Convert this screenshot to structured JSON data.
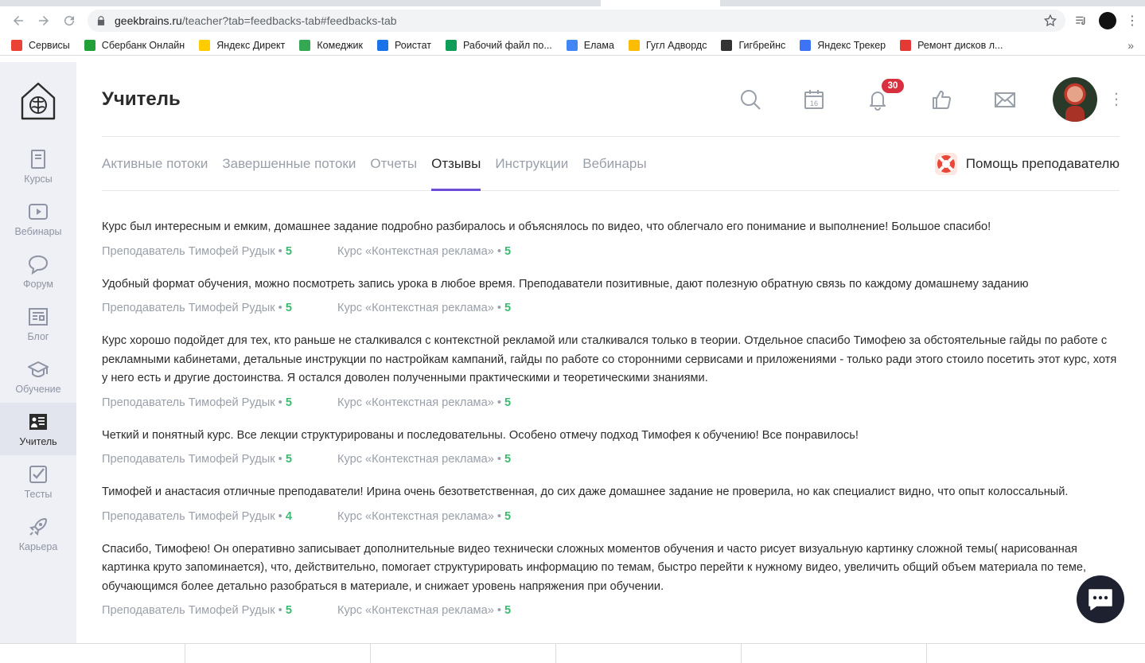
{
  "browser": {
    "url_host": "geekbrains.ru",
    "url_path": "/teacher?tab=feedbacks-tab#feedbacks-tab",
    "bookmarks": [
      {
        "label": "Сервисы",
        "color": "#ea4335"
      },
      {
        "label": "Сбербанк Онлайн",
        "color": "#21a038"
      },
      {
        "label": "Яндекс Директ",
        "color": "#ffcc00"
      },
      {
        "label": "Комеджик",
        "color": "#34a853"
      },
      {
        "label": "Роистат",
        "color": "#1a73e8"
      },
      {
        "label": "Рабочий файл по...",
        "color": "#0f9d58"
      },
      {
        "label": "Елама",
        "color": "#4285f4"
      },
      {
        "label": "Гугл Адвордс",
        "color": "#fbbc04"
      },
      {
        "label": "Гигбрейнс",
        "color": "#333333"
      },
      {
        "label": "Яндекс Трекер",
        "color": "#3d73f5"
      },
      {
        "label": "Ремонт дисков л...",
        "color": "#e53935"
      }
    ],
    "more": "»"
  },
  "sidebar": {
    "items": [
      {
        "label": "Курсы",
        "icon": "book-icon"
      },
      {
        "label": "Вебинары",
        "icon": "video-icon"
      },
      {
        "label": "Форум",
        "icon": "chat-bubble-icon"
      },
      {
        "label": "Блог",
        "icon": "newspaper-icon"
      },
      {
        "label": "Обучение",
        "icon": "graduation-cap-icon"
      },
      {
        "label": "Учитель",
        "icon": "teacher-board-icon"
      },
      {
        "label": "Тесты",
        "icon": "checkbox-icon"
      },
      {
        "label": "Карьера",
        "icon": "rocket-icon"
      }
    ],
    "active_index": 5
  },
  "header": {
    "title": "Учитель",
    "calendar_day": "16",
    "notifications_count": "30"
  },
  "tabs": [
    {
      "label": "Активные потоки"
    },
    {
      "label": "Завершенные потоки"
    },
    {
      "label": "Отчеты"
    },
    {
      "label": "Отзывы"
    },
    {
      "label": "Инструкции"
    },
    {
      "label": "Вебинары"
    }
  ],
  "active_tab_index": 3,
  "help_label": "Помощь преподавателю",
  "feedbacks": [
    {
      "text": "Курс был интересным и емким, домашнее задание подробно разбиралось и объяснялось по видео, что облегчало его понимание и выполнение! Большое спасибо!",
      "teacher": "Преподаватель Тимофей Рудык • ",
      "teacher_score": "5",
      "course": "Курс «Контекстная реклама» • ",
      "course_score": "5"
    },
    {
      "text": "Удобный формат обучения, можно посмотреть запись урока в любое время. Преподаватели позитивные, дают полезную обратную связь по каждому домашнему заданию",
      "teacher": "Преподаватель Тимофей Рудык • ",
      "teacher_score": "5",
      "course": "Курс «Контекстная реклама» • ",
      "course_score": "5"
    },
    {
      "text": "Курс хорошо подойдет для тех, кто раньше не сталкивался с контекстной рекламой или сталкивался только в теории. Отдельное спасибо Тимофею за обстоятельные гайды по работе с рекламными кабинетами, детальные инструкции по настройкам кампаний, гайды по работе со сторонними сервисами и приложениями - только ради этого стоило посетить этот курс, хотя у него есть и другие достоинства. Я остался доволен полученными практическими и теоретическими знаниями.",
      "teacher": "Преподаватель Тимофей Рудык • ",
      "teacher_score": "5",
      "course": "Курс «Контекстная реклама» • ",
      "course_score": "5"
    },
    {
      "text": "Четкий и понятный курс. Все лекции структурированы и последовательны. Особено отмечу подход Тимофея к обучению! Все понравилось!",
      "teacher": "Преподаватель Тимофей Рудык • ",
      "teacher_score": "5",
      "course": "Курс «Контекстная реклама» • ",
      "course_score": "5"
    },
    {
      "text": "Тимофей и анастасия отличные преподаватели! Ирина очень безответственная, до сих даже домашнее задание не проверила, но как специалист видно, что опыт колоссальный.",
      "teacher": "Преподаватель Тимофей Рудык • ",
      "teacher_score": "4",
      "course": "Курс «Контекстная реклама» • ",
      "course_score": "5"
    },
    {
      "text": "Спасибо, Тимофею! Он оперативно записывает дополнительные видео технически сложных моментов обучения и часто рисует визуальную картинку сложной темы( нарисованная картинка круто запоминается), что, действительно, помогает структурировать информацию по темам, быстро перейти к нужному видео, увеличить общий объем материала по теме, обучающимся более детально разобраться в материале, и снижает уровень напряжения при обучении.",
      "teacher": "Преподаватель Тимофей Рудык • ",
      "teacher_score": "5",
      "course": "Курс «Контекстная реклама» • ",
      "course_score": "5"
    }
  ],
  "colors": {
    "accent": "#6c4dd6",
    "score": "#3cba72",
    "badge": "#d8303f",
    "sidebar": "#eef0f5"
  }
}
